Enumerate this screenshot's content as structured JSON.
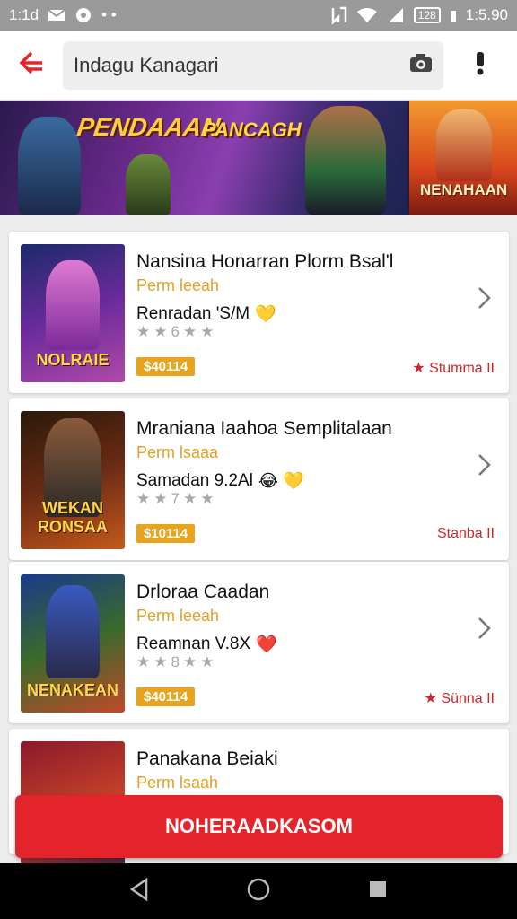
{
  "status_bar": {
    "time_left": "1:1d",
    "battery": "128",
    "time_right": "1:5.90"
  },
  "app_bar": {
    "search": {
      "value": "Indagu Kanagari"
    }
  },
  "banner": {
    "title_a": "PENDAAAN",
    "title_b": "PANCAGH",
    "side_title": "NENAHAAN"
  },
  "items": [
    {
      "title": "Nansina Honarran Plorm Bsal'l",
      "subtitle": "Perm leeah",
      "meta": "Renradan 'S/M",
      "emoji": "💛",
      "rating_text": "6",
      "price": "$40114",
      "tag": "Stumma II",
      "thumb_label": "NOLRAIE",
      "thumb_colors": [
        "#1b2a6a",
        "#6a2a9c",
        "#b04aa8"
      ]
    },
    {
      "title": "Mraniana Iaahoa Semplitalaan",
      "subtitle": "Perm lsaaa",
      "meta": "Samadan 9.2Al",
      "emoji": "😂 💛",
      "rating_text": "7",
      "price": "$10114",
      "tag": "Stanba II",
      "thumb_label": "WEKAN RONSAA",
      "thumb_colors": [
        "#2a1a0a",
        "#6a2a14",
        "#c45a1c"
      ]
    },
    {
      "title": "Drloraa Caadan",
      "subtitle": "Perm leeah",
      "meta": "Reamnan V.8X",
      "emoji": "❤️",
      "rating_text": "8",
      "price": "$40114",
      "tag": "Sünna II",
      "thumb_label": "NENAKEAN",
      "thumb_colors": [
        "#1a3a8a",
        "#3a6a2a",
        "#c04a2a"
      ]
    },
    {
      "title": "Panakana Beiaki",
      "subtitle": "Perm lsaah",
      "meta": "",
      "emoji": "",
      "rating_text": "",
      "price": "",
      "tag": "",
      "thumb_label": "",
      "thumb_colors": [
        "#8a1a2a",
        "#c4402a",
        "#3a1a4a"
      ]
    }
  ],
  "cta": {
    "label": "NOHERAADKASOM"
  },
  "colors": {
    "accent": "#e3242b",
    "price": "#e8a31f",
    "subtitle": "#e0a12a",
    "tag": "#d0262a"
  }
}
